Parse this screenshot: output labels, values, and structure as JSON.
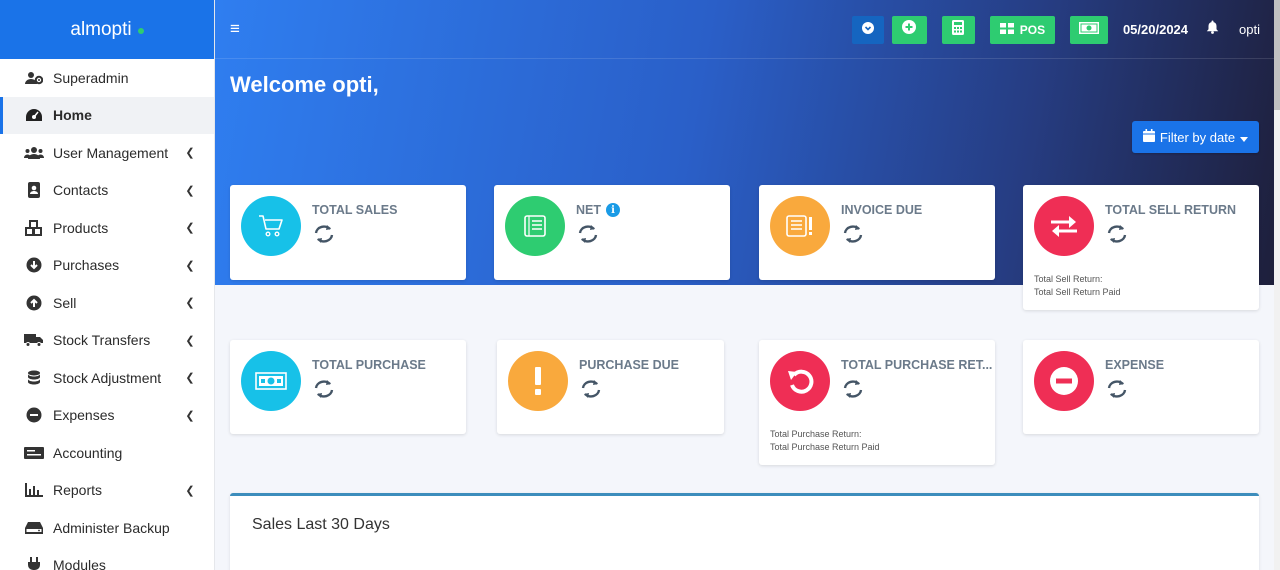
{
  "brand": {
    "name": "almopti"
  },
  "sidebar": {
    "items": [
      {
        "label": "Superadmin",
        "icon": "users-cog-icon",
        "chevron": false,
        "active": false
      },
      {
        "label": "Home",
        "icon": "tachometer-icon",
        "chevron": false,
        "active": true
      },
      {
        "label": "User Management",
        "icon": "users-icon",
        "chevron": true,
        "active": false
      },
      {
        "label": "Contacts",
        "icon": "address-book-icon",
        "chevron": true,
        "active": false
      },
      {
        "label": "Products",
        "icon": "cubes-icon",
        "chevron": true,
        "active": false
      },
      {
        "label": "Purchases",
        "icon": "arrow-circle-down-icon",
        "chevron": true,
        "active": false
      },
      {
        "label": "Sell",
        "icon": "arrow-circle-up-icon",
        "chevron": true,
        "active": false
      },
      {
        "label": "Stock Transfers",
        "icon": "truck-icon",
        "chevron": true,
        "active": false
      },
      {
        "label": "Stock Adjustment",
        "icon": "database-icon",
        "chevron": true,
        "active": false
      },
      {
        "label": "Expenses",
        "icon": "minus-circle-icon",
        "chevron": true,
        "active": false
      },
      {
        "label": "Accounting",
        "icon": "money-check-icon",
        "chevron": false,
        "active": false
      },
      {
        "label": "Reports",
        "icon": "bar-chart-icon",
        "chevron": true,
        "active": false
      },
      {
        "label": "Administer Backup",
        "icon": "hdd-icon",
        "chevron": false,
        "active": false
      },
      {
        "label": "Modules",
        "icon": "plug-icon",
        "chevron": false,
        "active": false
      }
    ]
  },
  "topbar": {
    "menu_icon": "≡",
    "pos_label": "POS",
    "date": "05/20/2024",
    "user": "opti"
  },
  "main": {
    "welcome": "Welcome opti,",
    "filter_label": "Filter by date",
    "cards": [
      {
        "title": "TOTAL SALES",
        "icon": "cart-icon",
        "color": "#17c1e8"
      },
      {
        "title": "NET",
        "icon": "ledger-icon",
        "color": "#2ecc71",
        "info": "i"
      },
      {
        "title": "INVOICE DUE",
        "icon": "invoice-alert-icon",
        "color": "#f9a93d"
      },
      {
        "title": "TOTAL SELL RETURN",
        "icon": "exchange-icon",
        "color": "#ef2e55",
        "sub1": "Total Sell Return:",
        "sub2": "Total Sell Return Paid"
      },
      {
        "title": "TOTAL PURCHASE",
        "icon": "money-bill-icon",
        "color": "#17c1e8"
      },
      {
        "title": "PURCHASE DUE",
        "icon": "exclamation-icon",
        "color": "#f9a93d"
      },
      {
        "title": "TOTAL PURCHASE RET...",
        "icon": "undo-icon",
        "color": "#ef2e55",
        "sub1": "Total Purchase Return:",
        "sub2": "Total Purchase Return Paid"
      },
      {
        "title": "EXPENSE",
        "icon": "minus-circle-icon",
        "color": "#ef2e55"
      }
    ],
    "chart_title": "Sales Last 30 Days"
  }
}
